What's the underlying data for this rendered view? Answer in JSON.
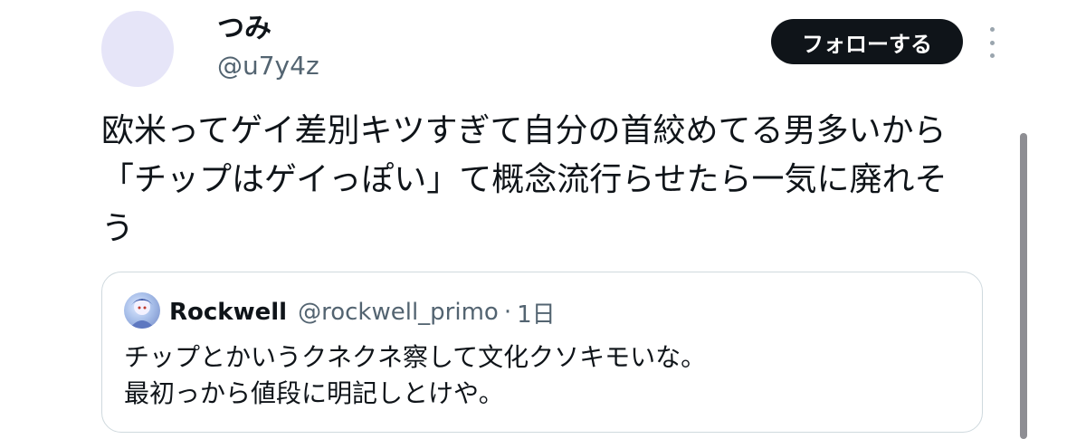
{
  "author": {
    "display_name": "つみ",
    "handle": "@u7y4z",
    "avatar_color": "#e6e5f8"
  },
  "actions": {
    "follow_label": "フォローする",
    "more_icon": "more-vertical-icon"
  },
  "tweet": {
    "text": "欧米ってゲイ差別キツすぎて自分の首絞めてる男多いから「チップはゲイっぽい」て概念流行らせたら一気に廃れそう"
  },
  "quote": {
    "display_name": "Rockwell",
    "handle": "@rockwell_primo",
    "separator": "·",
    "time": "1日",
    "text": "チップとかいうクネクネ察して文化クソキモいな。\n最初っから値段に明記しとけや。"
  },
  "colors": {
    "text_primary": "#0f1419",
    "text_secondary": "#536471",
    "follow_button_bg": "#0f1419",
    "border": "#cfd9de"
  }
}
